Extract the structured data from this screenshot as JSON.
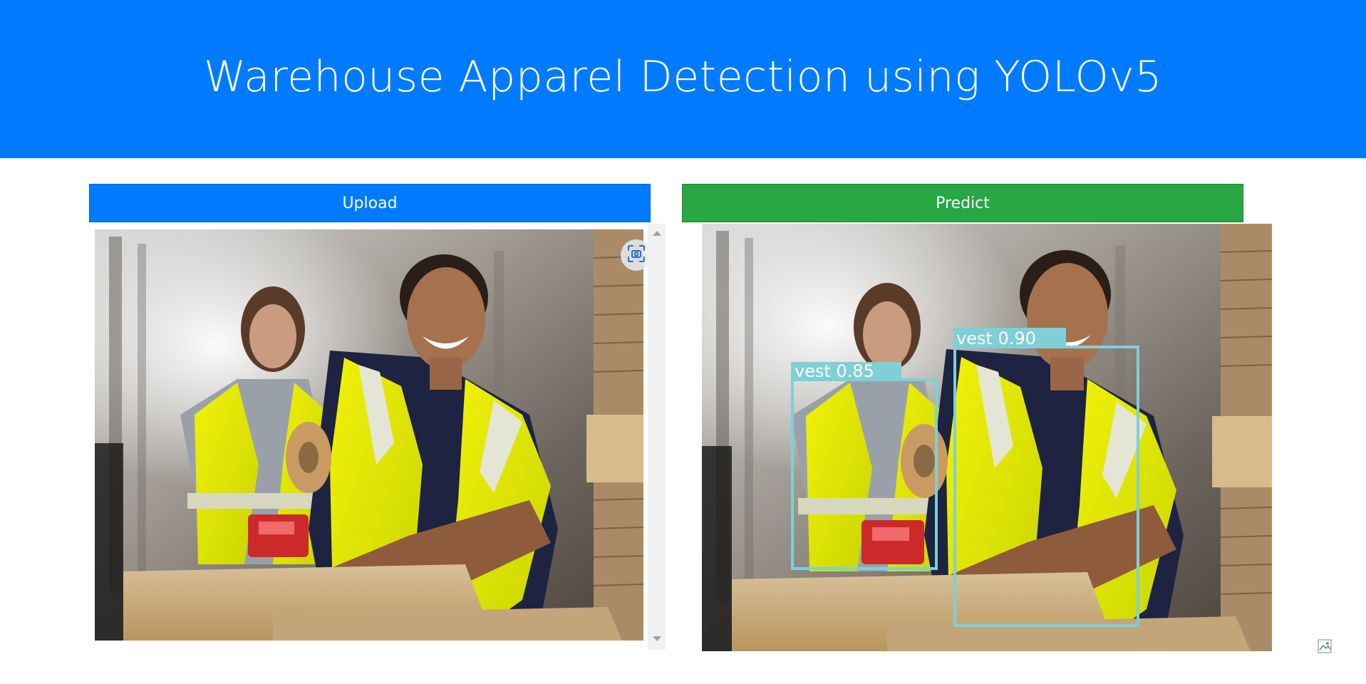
{
  "header": {
    "title": "Warehouse Apparel Detection using YOLOv5",
    "background_color": "#007bff"
  },
  "buttons": {
    "upload_label": "Upload",
    "predict_label": "Predict",
    "upload_color": "#007bff",
    "predict_color": "#28a745"
  },
  "upload_panel": {
    "image_description": "two warehouse workers in yellow hi-vis vests packing boxes",
    "screenshot_icon": "camera-scan-icon"
  },
  "prediction_panel": {
    "detections": [
      {
        "label": "vest",
        "confidence": "0.85",
        "text": "vest 0.85"
      },
      {
        "label": "vest",
        "confidence": "0.90",
        "text": "vest 0.90"
      }
    ],
    "box_color": "#7fcfd6"
  }
}
